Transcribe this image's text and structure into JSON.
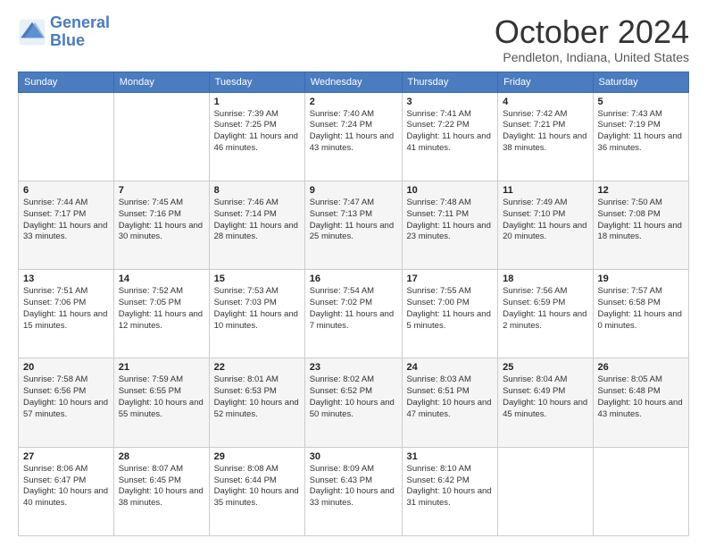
{
  "logo": {
    "line1": "General",
    "line2": "Blue"
  },
  "title": "October 2024",
  "subtitle": "Pendleton, Indiana, United States",
  "weekdays": [
    "Sunday",
    "Monday",
    "Tuesday",
    "Wednesday",
    "Thursday",
    "Friday",
    "Saturday"
  ],
  "weeks": [
    [
      {
        "day": "",
        "info": ""
      },
      {
        "day": "",
        "info": ""
      },
      {
        "day": "1",
        "info": "Sunrise: 7:39 AM\nSunset: 7:25 PM\nDaylight: 11 hours and 46 minutes."
      },
      {
        "day": "2",
        "info": "Sunrise: 7:40 AM\nSunset: 7:24 PM\nDaylight: 11 hours and 43 minutes."
      },
      {
        "day": "3",
        "info": "Sunrise: 7:41 AM\nSunset: 7:22 PM\nDaylight: 11 hours and 41 minutes."
      },
      {
        "day": "4",
        "info": "Sunrise: 7:42 AM\nSunset: 7:21 PM\nDaylight: 11 hours and 38 minutes."
      },
      {
        "day": "5",
        "info": "Sunrise: 7:43 AM\nSunset: 7:19 PM\nDaylight: 11 hours and 36 minutes."
      }
    ],
    [
      {
        "day": "6",
        "info": "Sunrise: 7:44 AM\nSunset: 7:17 PM\nDaylight: 11 hours and 33 minutes."
      },
      {
        "day": "7",
        "info": "Sunrise: 7:45 AM\nSunset: 7:16 PM\nDaylight: 11 hours and 30 minutes."
      },
      {
        "day": "8",
        "info": "Sunrise: 7:46 AM\nSunset: 7:14 PM\nDaylight: 11 hours and 28 minutes."
      },
      {
        "day": "9",
        "info": "Sunrise: 7:47 AM\nSunset: 7:13 PM\nDaylight: 11 hours and 25 minutes."
      },
      {
        "day": "10",
        "info": "Sunrise: 7:48 AM\nSunset: 7:11 PM\nDaylight: 11 hours and 23 minutes."
      },
      {
        "day": "11",
        "info": "Sunrise: 7:49 AM\nSunset: 7:10 PM\nDaylight: 11 hours and 20 minutes."
      },
      {
        "day": "12",
        "info": "Sunrise: 7:50 AM\nSunset: 7:08 PM\nDaylight: 11 hours and 18 minutes."
      }
    ],
    [
      {
        "day": "13",
        "info": "Sunrise: 7:51 AM\nSunset: 7:06 PM\nDaylight: 11 hours and 15 minutes."
      },
      {
        "day": "14",
        "info": "Sunrise: 7:52 AM\nSunset: 7:05 PM\nDaylight: 11 hours and 12 minutes."
      },
      {
        "day": "15",
        "info": "Sunrise: 7:53 AM\nSunset: 7:03 PM\nDaylight: 11 hours and 10 minutes."
      },
      {
        "day": "16",
        "info": "Sunrise: 7:54 AM\nSunset: 7:02 PM\nDaylight: 11 hours and 7 minutes."
      },
      {
        "day": "17",
        "info": "Sunrise: 7:55 AM\nSunset: 7:00 PM\nDaylight: 11 hours and 5 minutes."
      },
      {
        "day": "18",
        "info": "Sunrise: 7:56 AM\nSunset: 6:59 PM\nDaylight: 11 hours and 2 minutes."
      },
      {
        "day": "19",
        "info": "Sunrise: 7:57 AM\nSunset: 6:58 PM\nDaylight: 11 hours and 0 minutes."
      }
    ],
    [
      {
        "day": "20",
        "info": "Sunrise: 7:58 AM\nSunset: 6:56 PM\nDaylight: 10 hours and 57 minutes."
      },
      {
        "day": "21",
        "info": "Sunrise: 7:59 AM\nSunset: 6:55 PM\nDaylight: 10 hours and 55 minutes."
      },
      {
        "day": "22",
        "info": "Sunrise: 8:01 AM\nSunset: 6:53 PM\nDaylight: 10 hours and 52 minutes."
      },
      {
        "day": "23",
        "info": "Sunrise: 8:02 AM\nSunset: 6:52 PM\nDaylight: 10 hours and 50 minutes."
      },
      {
        "day": "24",
        "info": "Sunrise: 8:03 AM\nSunset: 6:51 PM\nDaylight: 10 hours and 47 minutes."
      },
      {
        "day": "25",
        "info": "Sunrise: 8:04 AM\nSunset: 6:49 PM\nDaylight: 10 hours and 45 minutes."
      },
      {
        "day": "26",
        "info": "Sunrise: 8:05 AM\nSunset: 6:48 PM\nDaylight: 10 hours and 43 minutes."
      }
    ],
    [
      {
        "day": "27",
        "info": "Sunrise: 8:06 AM\nSunset: 6:47 PM\nDaylight: 10 hours and 40 minutes."
      },
      {
        "day": "28",
        "info": "Sunrise: 8:07 AM\nSunset: 6:45 PM\nDaylight: 10 hours and 38 minutes."
      },
      {
        "day": "29",
        "info": "Sunrise: 8:08 AM\nSunset: 6:44 PM\nDaylight: 10 hours and 35 minutes."
      },
      {
        "day": "30",
        "info": "Sunrise: 8:09 AM\nSunset: 6:43 PM\nDaylight: 10 hours and 33 minutes."
      },
      {
        "day": "31",
        "info": "Sunrise: 8:10 AM\nSunset: 6:42 PM\nDaylight: 10 hours and 31 minutes."
      },
      {
        "day": "",
        "info": ""
      },
      {
        "day": "",
        "info": ""
      }
    ]
  ]
}
